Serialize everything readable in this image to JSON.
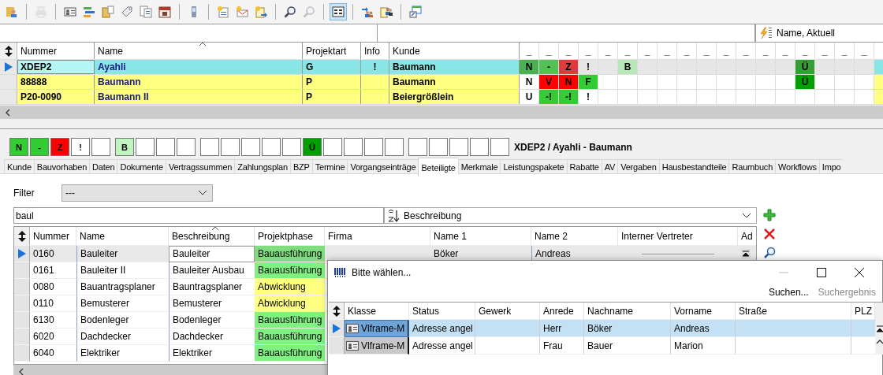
{
  "toolbar": [
    [
      {
        "kind": "user-folder",
        "disabled": false,
        "pressed": false
      }
    ],
    [
      {
        "kind": "printer",
        "disabled": true,
        "pressed": false
      }
    ],
    [
      {
        "kind": "id-card",
        "disabled": false,
        "pressed": false
      },
      {
        "kind": "bars",
        "disabled": false,
        "pressed": false
      },
      {
        "kind": "folder",
        "disabled": false,
        "pressed": false
      },
      {
        "kind": "tag",
        "disabled": false,
        "pressed": false
      },
      {
        "kind": "documents",
        "disabled": false,
        "pressed": false
      },
      {
        "kind": "calendar",
        "disabled": false,
        "pressed": false
      }
    ],
    [
      {
        "kind": "phone",
        "disabled": false,
        "pressed": false
      }
    ],
    [
      {
        "kind": "new-document",
        "disabled": false,
        "pressed": false
      },
      {
        "kind": "new-mail",
        "disabled": false,
        "pressed": false
      },
      {
        "kind": "new-export",
        "disabled": false,
        "pressed": false
      }
    ],
    [
      {
        "kind": "search",
        "disabled": false,
        "pressed": false
      },
      {
        "kind": "search",
        "disabled": true,
        "pressed": false
      }
    ],
    [
      {
        "kind": "layout",
        "disabled": false,
        "pressed": true
      }
    ],
    [
      {
        "kind": "people-arrow",
        "disabled": false,
        "pressed": false
      },
      {
        "kind": "people-document",
        "disabled": false,
        "pressed": false
      }
    ],
    [
      {
        "kind": "window-arrow",
        "disabled": false,
        "pressed": false
      }
    ]
  ],
  "view_selector": {
    "value": "Name, Aktuell"
  },
  "projects": {
    "columns": [
      "Nummer",
      "Name",
      "Projektart",
      "Info",
      "Kunde"
    ],
    "status_columns": [
      "_",
      "_",
      "_",
      "_",
      "_",
      "_",
      "_",
      "_",
      "_",
      "_",
      "_",
      "_",
      "_",
      "_",
      "_",
      "_",
      "_",
      "_"
    ],
    "rows": [
      {
        "selected": true,
        "color": "#8ae6e6",
        "nummer": "XDEP2",
        "name": "Ayahli",
        "projektart": "G",
        "info": "!",
        "kunde": "Baumann",
        "flags": [
          {
            "kind": "flag",
            "label": "N",
            "color": "#4caf50"
          },
          {
            "kind": "flag",
            "label": "-",
            "color": "#55c055"
          },
          {
            "kind": "flag",
            "label": "Z",
            "color": "#dd3c3c"
          },
          {
            "kind": "flag",
            "label": "!"
          },
          {
            "kind": "empty"
          },
          {
            "kind": "flag",
            "label": "B",
            "color": "#b8e8b8"
          },
          {
            "kind": "empty"
          },
          {
            "kind": "empty"
          },
          {
            "kind": "empty"
          },
          {
            "kind": "empty"
          },
          {
            "kind": "empty"
          },
          {
            "kind": "empty"
          },
          {
            "kind": "empty"
          },
          {
            "kind": "empty"
          },
          {
            "kind": "flag",
            "label": "Ü",
            "color": "#33a033"
          },
          {
            "kind": "empty"
          },
          {
            "kind": "empty"
          },
          {
            "kind": "empty"
          }
        ]
      },
      {
        "selected": false,
        "color": "#ffff80",
        "nummer": "88888",
        "name": "Baumann",
        "projektart": "P",
        "kunde": "Baumann",
        "flags": [
          {
            "kind": "flag",
            "label": "N"
          },
          {
            "kind": "flag",
            "label": "V",
            "color": "#ff0000"
          },
          {
            "kind": "flag",
            "label": "N",
            "color": "#ff0000"
          },
          {
            "kind": "flag",
            "label": "F",
            "color": "#33cc33"
          },
          {
            "kind": "empty"
          },
          {
            "kind": "empty"
          },
          {
            "kind": "empty"
          },
          {
            "kind": "empty"
          },
          {
            "kind": "empty"
          },
          {
            "kind": "empty"
          },
          {
            "kind": "empty"
          },
          {
            "kind": "empty"
          },
          {
            "kind": "empty"
          },
          {
            "kind": "empty"
          },
          {
            "kind": "flag",
            "label": "Ü",
            "color": "#00a000"
          },
          {
            "kind": "empty"
          },
          {
            "kind": "empty"
          },
          {
            "kind": "empty"
          }
        ]
      },
      {
        "selected": false,
        "color": "#ffff80",
        "nummer": "P20-0090",
        "name": "Baumann II",
        "projektart": "P",
        "kunde": "Beiergrößlein",
        "flags": [
          {
            "kind": "flag",
            "label": "U"
          },
          {
            "kind": "flag",
            "label": "-!",
            "color": "#33cc33"
          },
          {
            "kind": "flag",
            "label": "-!",
            "color": "#33cc33"
          },
          {
            "kind": "flag",
            "label": "!"
          },
          {
            "kind": "empty"
          },
          {
            "kind": "empty"
          },
          {
            "kind": "empty"
          },
          {
            "kind": "empty"
          },
          {
            "kind": "empty"
          },
          {
            "kind": "empty"
          },
          {
            "kind": "empty"
          },
          {
            "kind": "empty"
          },
          {
            "kind": "empty"
          },
          {
            "kind": "empty"
          },
          {
            "kind": "empty"
          },
          {
            "kind": "empty"
          },
          {
            "kind": "empty"
          },
          {
            "kind": "empty"
          }
        ]
      }
    ]
  },
  "record": {
    "flags": [
      {
        "kind": "flag",
        "label": "N",
        "color": "#33cc33"
      },
      {
        "kind": "flag",
        "label": "-",
        "color": "#33cc33"
      },
      {
        "kind": "flag",
        "label": "Z",
        "color": "#ff0000"
      },
      {
        "kind": "flag",
        "label": "!"
      },
      {
        "kind": "empty"
      },
      {
        "kind": "flag",
        "label": "B",
        "color": "#c0f5c0"
      },
      {
        "kind": "empty"
      },
      {
        "kind": "empty"
      },
      {
        "kind": "empty"
      },
      {
        "kind": "empty"
      },
      {
        "kind": "empty"
      },
      {
        "kind": "empty"
      },
      {
        "kind": "empty"
      },
      {
        "kind": "empty"
      },
      {
        "kind": "flag",
        "label": "Ü",
        "color": "#00a000"
      },
      {
        "kind": "empty"
      },
      {
        "kind": "empty"
      },
      {
        "kind": "empty"
      },
      {
        "kind": "empty"
      },
      {
        "kind": "empty"
      },
      {
        "kind": "empty"
      },
      {
        "kind": "empty"
      },
      {
        "kind": "empty"
      },
      {
        "kind": "empty"
      }
    ],
    "title": "XDEP2 / Ayahli - Baumann"
  },
  "tabs": [
    {
      "label": "Kunde",
      "selected": false
    },
    {
      "label": "Bauvorhaben",
      "selected": false
    },
    {
      "label": "Daten",
      "selected": false
    },
    {
      "label": "Dokumente",
      "selected": false
    },
    {
      "label": "Vertragssummen",
      "selected": false
    },
    {
      "label": "Zahlungsplan",
      "selected": false
    },
    {
      "label": "BZP",
      "selected": false
    },
    {
      "label": "Termine",
      "selected": false
    },
    {
      "label": "Vorgangseinträge",
      "selected": false
    },
    {
      "label": "Beteiligte",
      "selected": true
    },
    {
      "label": "Merkmale",
      "selected": false
    },
    {
      "label": "Leistungspakete",
      "selected": false
    },
    {
      "label": "Rabatte",
      "selected": false
    },
    {
      "label": "AV",
      "selected": false
    },
    {
      "label": "Vergaben",
      "selected": false
    },
    {
      "label": "Hausbestandteile",
      "selected": false
    },
    {
      "label": "Raumbuch",
      "selected": false
    },
    {
      "label": "Workflows",
      "selected": false
    },
    {
      "label": "Impo",
      "selected": false
    }
  ],
  "filter": {
    "label": "Filter",
    "value": "---"
  },
  "search": {
    "value": "baul"
  },
  "sort": {
    "value": "Beschreibung"
  },
  "participants": {
    "columns": [
      "Nummer",
      "Name",
      "Beschreibung",
      "Projektphase",
      "Firma",
      "Name 1",
      "Name 2",
      "Interner Vertreter",
      "Ad"
    ],
    "rows": [
      {
        "selected": true,
        "nummer": "0160",
        "name": "Bauleiter",
        "beschreibung": "Bauleiter",
        "phase": {
          "label": "Bauausführung",
          "color": "#7fdc7f"
        },
        "name_1": "Böker",
        "name_2": "Andreas"
      },
      {
        "selected": false,
        "nummer": "0161",
        "name": "Bauleiter II",
        "beschreibung": "Bauleiter Ausbau",
        "phase": {
          "label": "Bauausführung",
          "color": "#80f080"
        }
      },
      {
        "selected": false,
        "nummer": "0080",
        "name": "Bauantragsplaner",
        "beschreibung": "Bauntragsplaner",
        "phase": {
          "label": "Abwicklung",
          "color": "#ffff80"
        }
      },
      {
        "selected": false,
        "nummer": "0110",
        "name": "Bemusterer",
        "beschreibung": "Bemusterer",
        "phase": {
          "label": "Abwicklung",
          "color": "#ffff80"
        }
      },
      {
        "selected": false,
        "nummer": "6130",
        "name": "Bodenleger",
        "beschreibung": "Bodenleger",
        "phase": {
          "label": "Bauausführung",
          "color": "#80f080"
        }
      },
      {
        "selected": false,
        "nummer": "6020",
        "name": "Dachdecker",
        "beschreibung": "Dachdecker",
        "phase": {
          "label": "Bauausführung",
          "color": "#80f080"
        }
      },
      {
        "selected": false,
        "nummer": "6040",
        "name": "Elektriker",
        "beschreibung": "Elektriker",
        "phase": {
          "label": "Bauausführung",
          "color": "#80f080"
        }
      }
    ]
  },
  "dialog": {
    "title": "Bitte wählen...",
    "actions": [
      {
        "label": "Suchen...",
        "disabled": false
      },
      {
        "label": "Suchergebnis",
        "disabled": true
      }
    ],
    "columns": [
      "Klasse",
      "Status",
      "Gewerk",
      "Anrede",
      "Nachname",
      "Vorname",
      "Straße",
      "PLZ"
    ],
    "rows": [
      {
        "selected": true,
        "klasse": "Vlframe-M",
        "status": "Adresse angel",
        "anrede": "Herr",
        "nachname": "Böker",
        "vorname": "Andreas"
      },
      {
        "selected": false,
        "klasse": "Vlframe-M",
        "status": "Adresse angel",
        "anrede": "Frau",
        "nachname": "Bauer",
        "vorname": "Marion"
      }
    ]
  }
}
